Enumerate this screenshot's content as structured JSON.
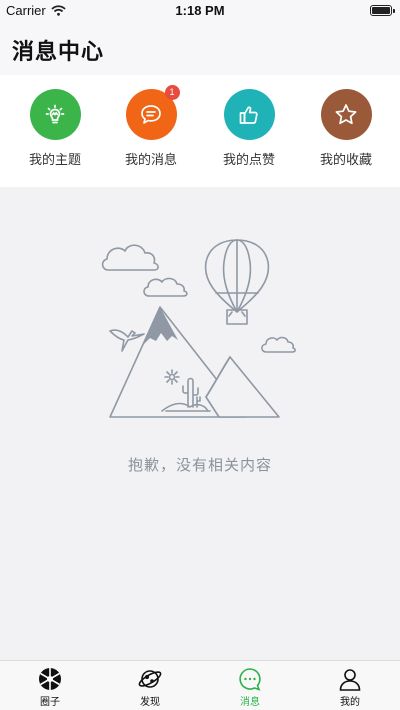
{
  "status_bar": {
    "carrier": "Carrier",
    "time": "1:18 PM"
  },
  "header": {
    "title": "消息中心"
  },
  "shortcuts": [
    {
      "label": "我的主题",
      "icon": "lightbulb-icon",
      "color": "#3bb54a"
    },
    {
      "label": "我的消息",
      "icon": "chat-bubble-icon",
      "color": "#f06516",
      "badge": "1"
    },
    {
      "label": "我的点赞",
      "icon": "thumbs-up-icon",
      "color": "#1fb3b8"
    },
    {
      "label": "我的收藏",
      "icon": "star-icon",
      "color": "#9a5a3a"
    }
  ],
  "empty_state": {
    "message": "抱歉，没有相关内容",
    "illustration": "mountain-balloon-illustration"
  },
  "tabbar": {
    "active_color": "#2db24a",
    "items": [
      {
        "label": "圈子",
        "icon": "aperture-icon"
      },
      {
        "label": "发现",
        "icon": "planet-icon"
      },
      {
        "label": "消息",
        "icon": "message-icon",
        "active": true
      },
      {
        "label": "我的",
        "icon": "user-icon"
      }
    ]
  }
}
